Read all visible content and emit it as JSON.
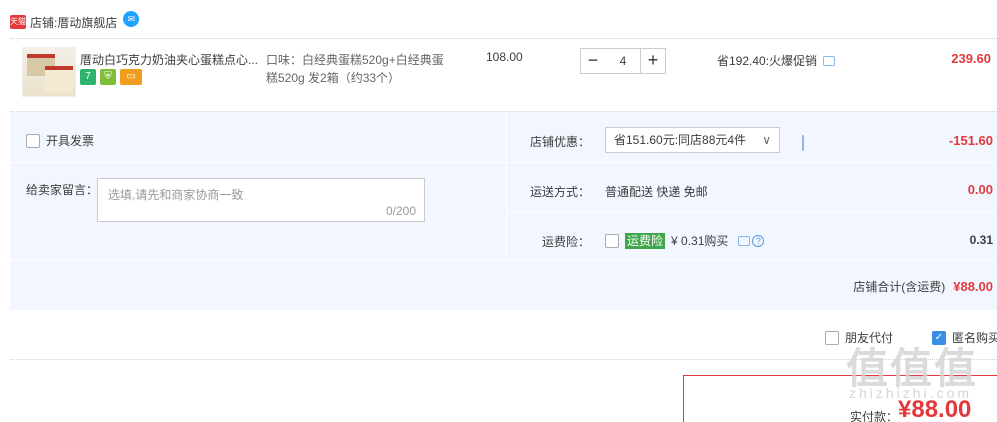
{
  "shop": {
    "badge": "天猫",
    "label": "店铺:",
    "name": "厝动旗舰店",
    "chat_icon": "wangwang-icon"
  },
  "item": {
    "title": "厝动白巧克力奶油夹心蛋糕点心...",
    "sku_line1": "口味：白经典蛋糕520g+白经典蛋",
    "sku_line2": "糕520g 发2箱（约33个）",
    "price": "108.00",
    "quantity": "4",
    "qty_minus": "−",
    "qty_plus": "+",
    "promo": "省192.40:火爆促销",
    "total": "239.60",
    "badge_7": "7"
  },
  "options": {
    "invoice_label": "开具发票",
    "message_label": "给卖家留言：",
    "message_placeholder": "选填,请先和商家协商一致",
    "message_count": "0/200",
    "discount_label": "店铺优惠：",
    "discount_selected": "省151.60元:同店88元4件",
    "discount_value": "-151.60",
    "shipping_label": "运送方式：",
    "shipping_value": "普通配送 快递 免邮",
    "shipping_fee": "0.00",
    "insurance_label": "运费险：",
    "insurance_tag": "运费险",
    "insurance_price": "¥ 0.31购买",
    "insurance_value": "0.31",
    "shop_total_label": "店铺合计(含运费)",
    "shop_total_value": "¥88.00"
  },
  "footer": {
    "friend_pay_label": "朋友代付",
    "anonymous_label": "匿名购买",
    "pay_label": "实付款：",
    "pay_value": "¥88.00"
  },
  "watermark": {
    "text": "值值值",
    "sub": "zhizhizhi.com"
  }
}
